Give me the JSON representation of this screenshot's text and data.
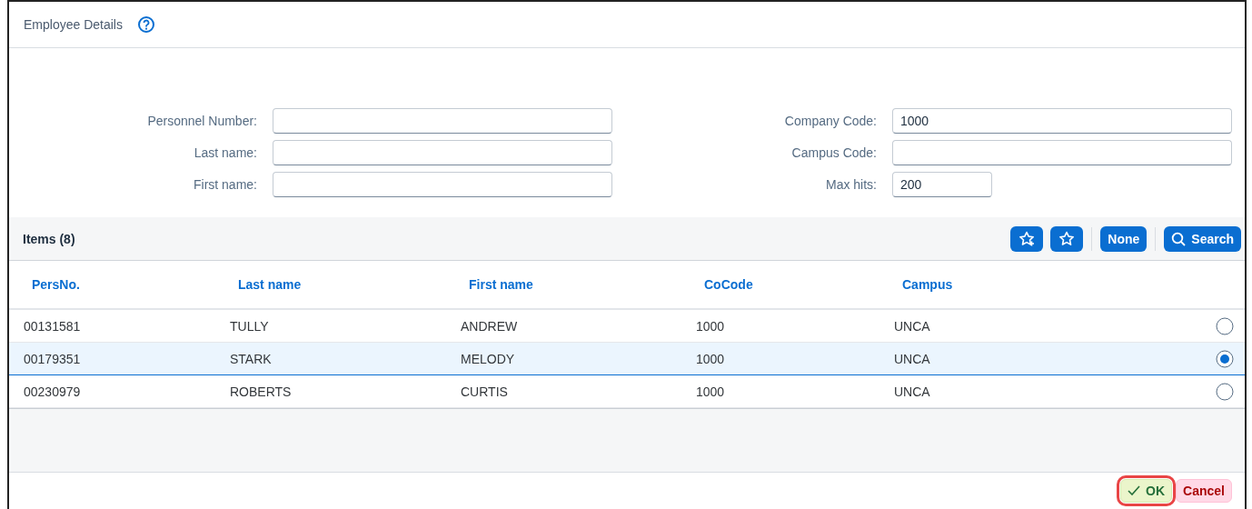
{
  "window": {
    "title": "Employee Details"
  },
  "form": {
    "left": [
      {
        "label": "Personnel Number:",
        "kind": "wide"
      },
      {
        "label": "Last name:",
        "kind": "wide"
      },
      {
        "label": "First name:",
        "kind": "wide"
      }
    ],
    "right": [
      {
        "label": "Company Code:",
        "value": "1000",
        "kind": "wide"
      },
      {
        "label": "Campus Code:",
        "kind": "wide"
      },
      {
        "label": "Max hits:",
        "value": "200",
        "kind": "short"
      }
    ]
  },
  "toolbar": {
    "title": "Items (8)",
    "buttons": [
      {
        "kind": "star-add"
      },
      {
        "kind": "star"
      },
      {
        "kind": "text",
        "label": "None"
      },
      {
        "kind": "search",
        "label": "Search"
      }
    ]
  },
  "table": {
    "columns": [
      "PersNo.",
      "Last name",
      "First name",
      "CoCode",
      "Campus"
    ],
    "rows": [
      {
        "cells": [
          "00131581",
          "TULLY",
          "ANDREW",
          "1000",
          "UNCA"
        ],
        "selected": false
      },
      {
        "cells": [
          "00179351",
          "STARK",
          "MELODY",
          "1000",
          "UNCA"
        ],
        "selected": true
      },
      {
        "cells": [
          "00230979",
          "ROBERTS",
          "CURTIS",
          "1000",
          "UNCA"
        ],
        "selected": false
      }
    ]
  },
  "footer": {
    "buttons": [
      {
        "kind": "accept",
        "label": "OK",
        "highlighted": true
      },
      {
        "kind": "reject",
        "label": "Cancel",
        "highlighted": false
      }
    ]
  }
}
